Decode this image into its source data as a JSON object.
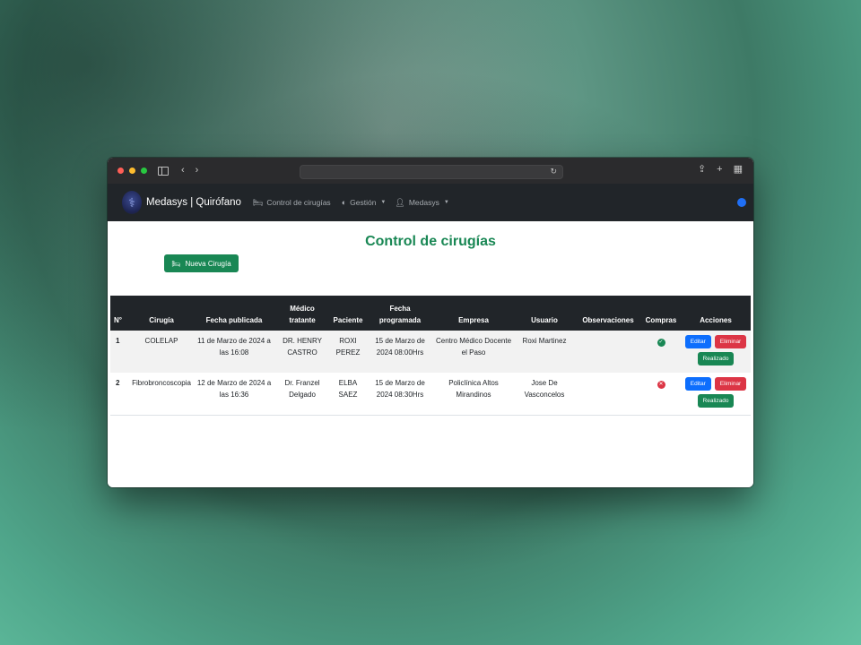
{
  "app": {
    "brand": "Medasys | Quirófano",
    "nav": [
      {
        "label": "Control de cirugías",
        "icon": "bed-icon"
      },
      {
        "label": "Gestión",
        "icon": "shield-icon"
      },
      {
        "label": "Medasys",
        "icon": "user-icon"
      }
    ],
    "colors": {
      "primary": "#198754",
      "navbar": "#212529",
      "status": "#1f6ff5"
    }
  },
  "page": {
    "title": "Control de cirugías",
    "new_button": "Nueva Cirugía"
  },
  "table": {
    "headers": [
      "N°",
      "Cirugía",
      "Fecha publicada",
      "Médico tratante",
      "Paciente",
      "Fecha programada",
      "Empresa",
      "Usuario",
      "Observaciones",
      "Compras",
      "Acciones"
    ],
    "rows": [
      {
        "num": "1",
        "cirugia": "COLELAP",
        "fecha_publicada": "11 de Marzo de 2024 a las 16:08",
        "medico": "DR. HENRY CASTRO",
        "paciente": "ROXI PEREZ",
        "fecha_programada": "15 de Marzo de 2024 08:00Hrs",
        "empresa": "Centro Médico Docente el Paso",
        "usuario": "Roxi Martinez",
        "observaciones": "",
        "compras": "ok",
        "actions": {
          "edit": "Editar",
          "delete": "Eliminar",
          "done": "Realizado"
        }
      },
      {
        "num": "2",
        "cirugia": "Fibrobroncoscopia",
        "fecha_publicada": "12 de Marzo de 2024 a las 16:36",
        "medico": "Dr. Franzel Delgado",
        "paciente": "ELBA SAEZ",
        "fecha_programada": "15 de Marzo de 2024 08:30Hrs",
        "empresa": "Policlínica Altos Mirandinos",
        "usuario": "Jose De Vasconcelos",
        "observaciones": "",
        "compras": "no",
        "actions": {
          "edit": "Editar",
          "delete": "Eliminar",
          "done": "Realizado"
        }
      }
    ]
  }
}
